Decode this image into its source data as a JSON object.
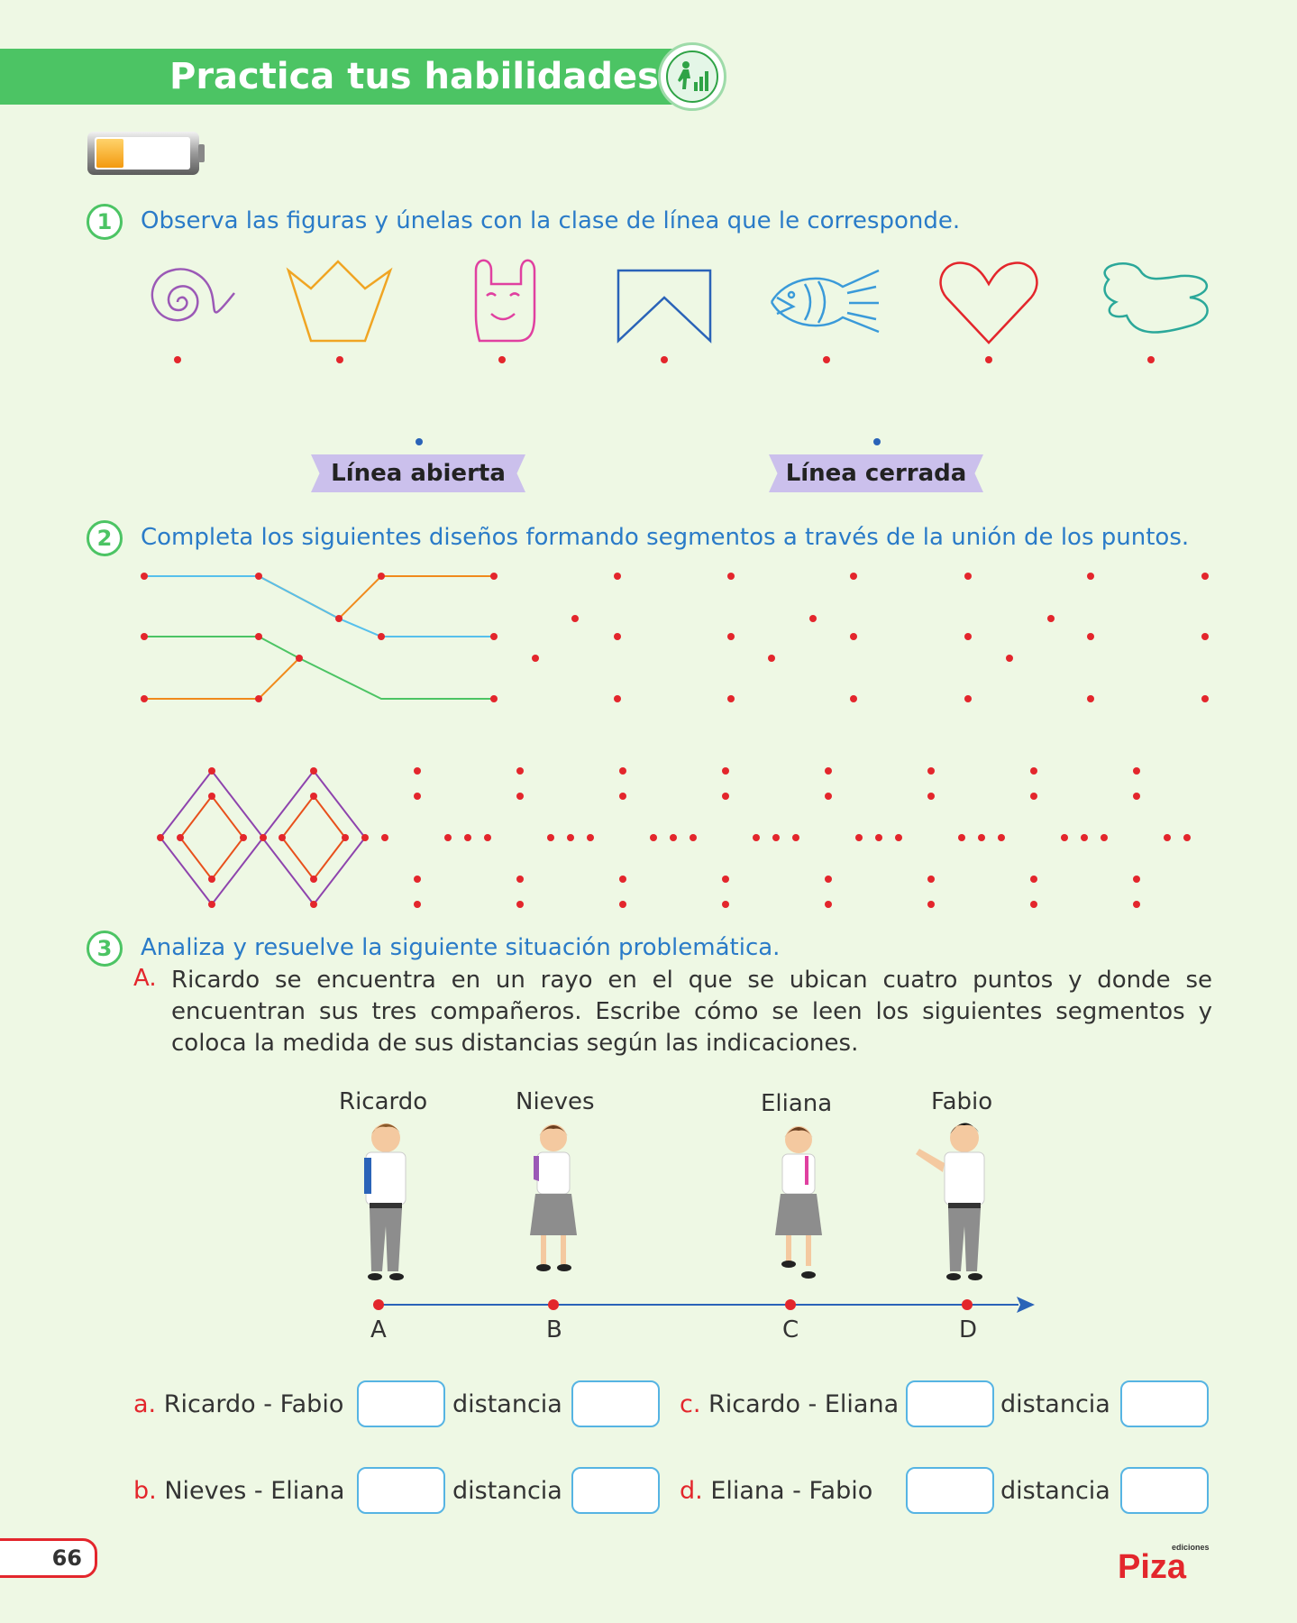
{
  "header": {
    "title": "Practica tus habilidades",
    "badge_icon": "climb-stairs-chart-icon"
  },
  "battery_icon": "battery-low-icon",
  "q1": {
    "number": "1",
    "text": "Observa las figuras y únelas con la clase de línea que le corresponde.",
    "figures": [
      "spiral-icon",
      "crown-icon",
      "bunny-icon",
      "banner-icon",
      "fish-icon",
      "heart-icon",
      "blob-icon"
    ],
    "labels": [
      "Línea abierta",
      "Línea cerrada"
    ]
  },
  "q2": {
    "number": "2",
    "text": "Completa los siguientes diseños formando segmentos a través de la unión de los puntos."
  },
  "q3": {
    "number": "3",
    "text": "Analiza y resuelve la siguiente situación problemática.",
    "part_letter": "A.",
    "part_text": "Ricardo se encuentra en un rayo en el que se ubican cuatro puntos y donde se encuentran sus tres compañeros. Escribe cómo se leen los siguientes segmentos y coloca la medida de sus distancias según las indicaciones.",
    "kids": [
      "Ricardo",
      "Nieves",
      "Eliana",
      "Fabio"
    ],
    "points": [
      "A",
      "B",
      "C",
      "D"
    ],
    "answers": [
      {
        "letter": "a.",
        "label": "Ricardo - Fabio",
        "dist": "distancia"
      },
      {
        "letter": "b.",
        "label": "Nieves - Eliana",
        "dist": "distancia"
      },
      {
        "letter": "c.",
        "label": "Ricardo - Eliana",
        "dist": "distancia"
      },
      {
        "letter": "d.",
        "label": "Eliana - Fabio",
        "dist": "distancia"
      }
    ]
  },
  "footer": {
    "page_number": "66",
    "logo_small": "ediciones",
    "logo_main": "Piza"
  },
  "colors": {
    "green": "#4cc464",
    "blue_text": "#2a7bc8",
    "red_dot": "#e3262c",
    "purple_tag": "#cbc0ec"
  }
}
